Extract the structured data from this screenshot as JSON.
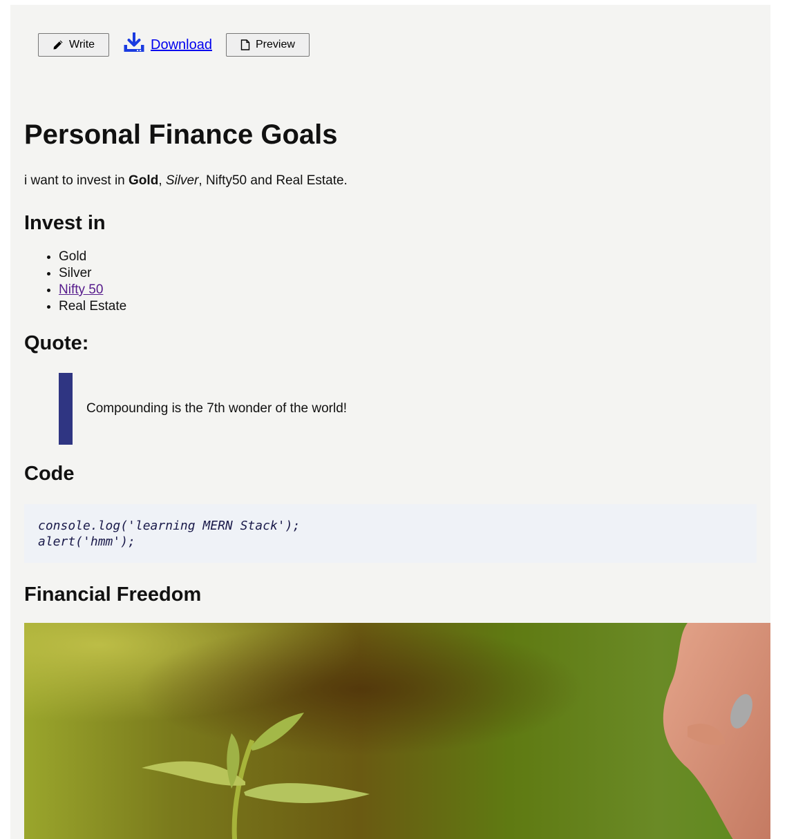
{
  "toolbar": {
    "write_label": "Write",
    "download_label": "Download",
    "preview_label": "Preview"
  },
  "document": {
    "title": "Personal Finance Goals",
    "intro": {
      "prefix": "i want to invest in ",
      "bold": "Gold",
      "sep1": ", ",
      "italic": "Silver",
      "suffix": ", Nifty50 and Real Estate."
    },
    "invest_heading": "Invest in",
    "invest_items": [
      "Gold",
      "Silver",
      "Nifty 50",
      "Real Estate"
    ],
    "quote_heading": "Quote:",
    "quote_text": "Compounding is the 7th wonder of the world!",
    "code_heading": "Code",
    "code_lines": [
      "console.log('learning MERN Stack');",
      "alert('hmm');"
    ],
    "image_heading": "Financial Freedom"
  },
  "colors": {
    "panel_bg": "#f4f4f2",
    "link": "#0000ee",
    "visited_link": "#551a8b",
    "quote_bar": "#2f3582",
    "code_bg": "#eff2f7"
  },
  "icons": {
    "write": "pencil-icon",
    "download": "download-icon",
    "preview": "document-icon"
  }
}
